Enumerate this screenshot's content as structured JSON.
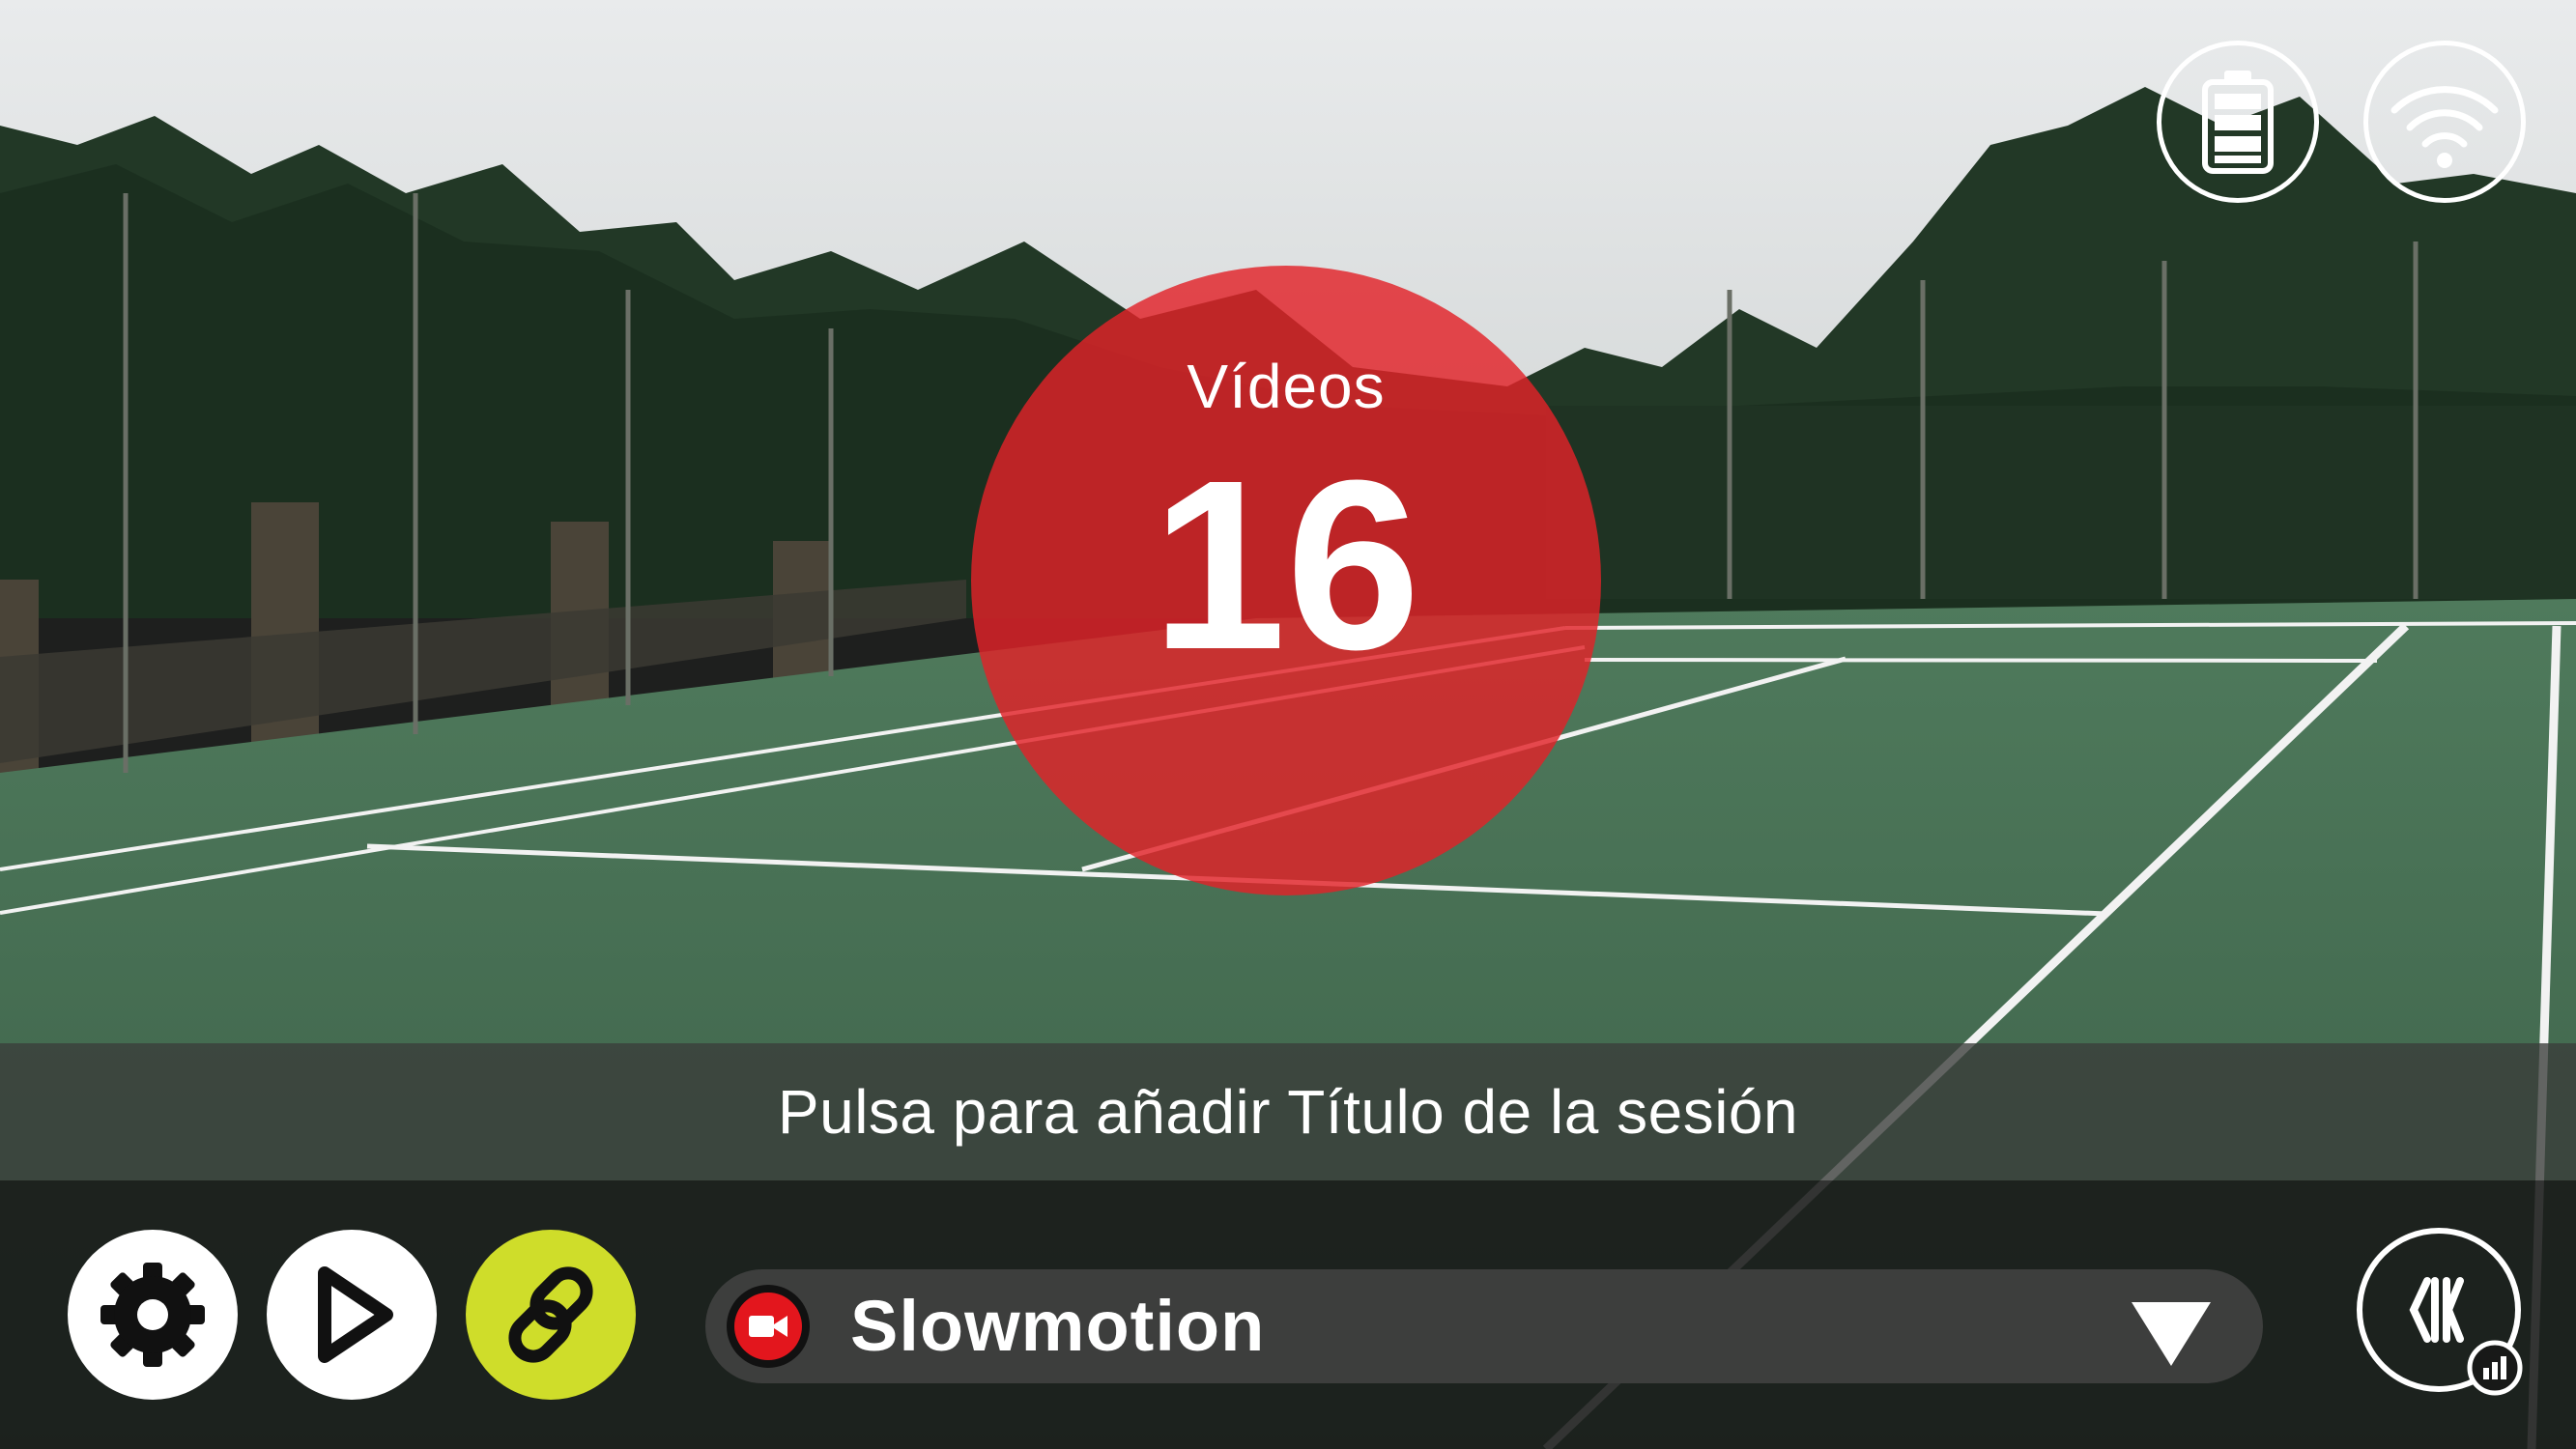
{
  "status": {
    "battery_icon": "battery-full-icon",
    "wifi_icon": "wifi-icon"
  },
  "counter": {
    "label": "Vídeos",
    "value": "16",
    "color": "#e22228"
  },
  "session": {
    "title_prompt": "Pulsa para añadir Título de la sesión"
  },
  "toolbar": {
    "settings_icon": "gear-icon",
    "play_icon": "play-icon",
    "link_icon": "link-icon",
    "link_color": "#cfdd2a",
    "mode": {
      "icon": "video-camera-icon",
      "selected": "Slowmotion",
      "dropdown_icon": "chevron-down-icon"
    },
    "brand_icon": "brand-logo-icon"
  }
}
